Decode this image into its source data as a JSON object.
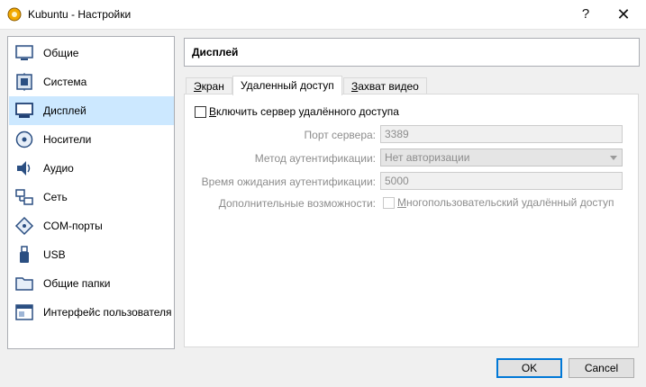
{
  "window": {
    "title": "Kubuntu - Настройки",
    "help_label": "?",
    "close_label": "✕"
  },
  "sidebar": {
    "items": [
      {
        "label": "Общие",
        "icon": "general-icon"
      },
      {
        "label": "Система",
        "icon": "system-chip-icon"
      },
      {
        "label": "Дисплей",
        "icon": "display-monitor-icon",
        "selected": true
      },
      {
        "label": "Носители",
        "icon": "storage-disc-icon"
      },
      {
        "label": "Аудио",
        "icon": "audio-speaker-icon"
      },
      {
        "label": "Сеть",
        "icon": "network-icon"
      },
      {
        "label": "COM-порты",
        "icon": "serial-port-icon"
      },
      {
        "label": "USB",
        "icon": "usb-icon"
      },
      {
        "label": "Общие папки",
        "icon": "shared-folder-icon"
      },
      {
        "label": "Интерфейс пользователя",
        "icon": "user-interface-icon"
      }
    ]
  },
  "page": {
    "title": "Дисплей",
    "tabs": [
      {
        "label": "Экран",
        "underline": "Э",
        "rest": "кран"
      },
      {
        "label": "Удаленный доступ",
        "active": true
      },
      {
        "label": "Захват видео",
        "underline": "З",
        "rest": "ахват видео"
      }
    ],
    "remote": {
      "enable_label_u": "В",
      "enable_label_rest": "ключить сервер удалённого доступа",
      "port_label": "Порт сервера:",
      "port_value": "3389",
      "auth_label": "Метод аутентификации:",
      "auth_value": "Нет авторизации",
      "timeout_label": "Время ожидания аутентификации:",
      "timeout_value": "5000",
      "extra_label": "Дополнительные возможности:",
      "multi_label_u": "М",
      "multi_label_rest": "ногопользовательский удалённый доступ"
    }
  },
  "buttons": {
    "ok": "OK",
    "cancel": "Cancel"
  }
}
